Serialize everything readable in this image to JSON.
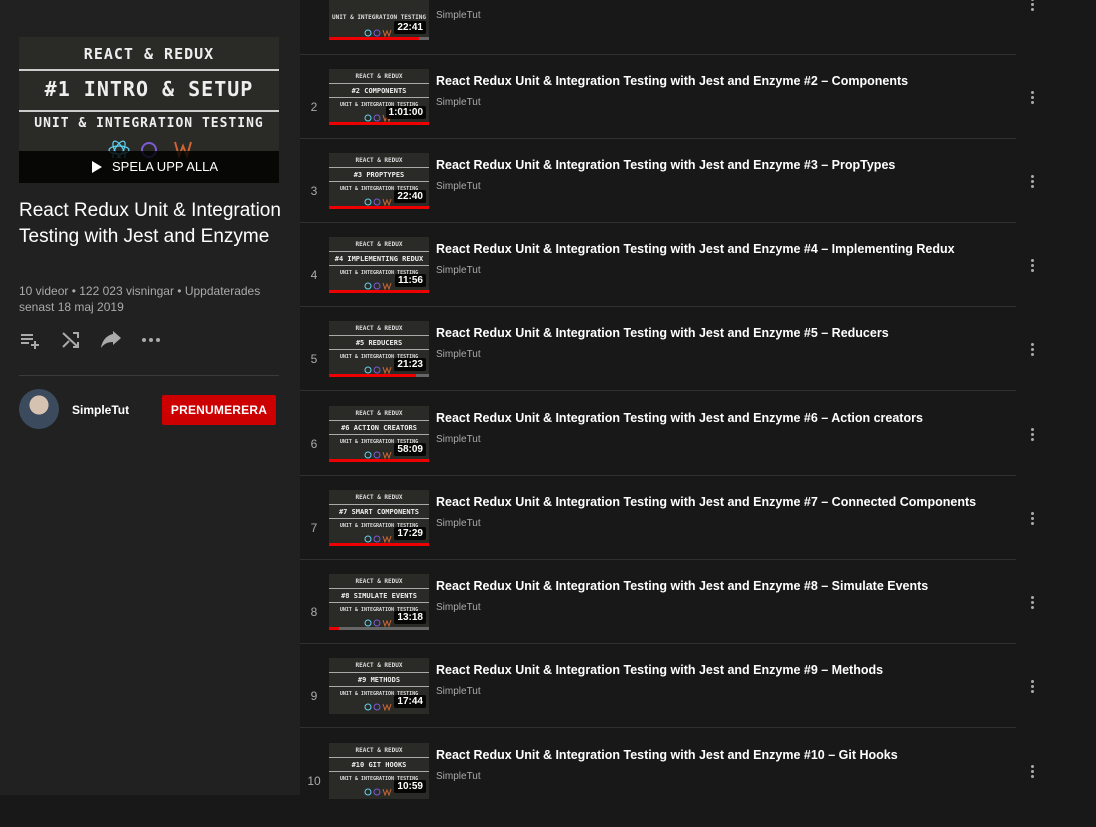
{
  "playlist": {
    "hero": {
      "line1": "REACT & REDUX",
      "line2": "#1 INTRO & SETUP",
      "line3": "UNIT & INTEGRATION TESTING",
      "play_all": "SPELA UPP ALLA"
    },
    "title": "React Redux Unit & Integration Testing with Jest and Enzyme",
    "meta": "10 videor • 122 023 visningar • Uppdaterades senast 18 maj 2019",
    "actions": [
      "add-to-queue-icon",
      "shuffle-icon",
      "share-icon",
      "more-horizontal-icon"
    ],
    "owner": "SimpleTut",
    "subscribe_label": "PRENUMERERA"
  },
  "thumb_common": {
    "top": "REACT & REDUX",
    "sub": "UNIT & INTEGRATION TESTING"
  },
  "partial_row": {
    "channel": "SimpleTut",
    "duration": "22:41",
    "progress": 0.9
  },
  "videos": [
    {
      "index": "2",
      "thumb_label": "#2 COMPONENTS",
      "title": "React Redux Unit & Integration Testing with Jest and Enzyme #2 – Components",
      "channel": "SimpleTut",
      "duration": "1:01:00",
      "progress": 1.0
    },
    {
      "index": "3",
      "thumb_label": "#3 PROPTYPES",
      "title": "React Redux Unit & Integration Testing with Jest and Enzyme #3 – PropTypes",
      "channel": "SimpleTut",
      "duration": "22:40",
      "progress": 1.0
    },
    {
      "index": "4",
      "thumb_label": "#4 IMPLEMENTING REDUX",
      "title": "React Redux Unit & Integration Testing with Jest and Enzyme #4 – Implementing Redux",
      "channel": "SimpleTut",
      "duration": "11:56",
      "progress": 1.0
    },
    {
      "index": "5",
      "thumb_label": "#5 REDUCERS",
      "title": "React Redux Unit & Integration Testing with Jest and Enzyme #5 – Reducers",
      "channel": "SimpleTut",
      "duration": "21:23",
      "progress": 0.87
    },
    {
      "index": "6",
      "thumb_label": "#6 ACTION CREATORS",
      "title": "React Redux Unit & Integration Testing with Jest and Enzyme #6 – Action creators",
      "channel": "SimpleTut",
      "duration": "58:09",
      "progress": 1.0
    },
    {
      "index": "7",
      "thumb_label": "#7 SMART COMPONENTS",
      "title": "React Redux Unit & Integration Testing with Jest and Enzyme #7 – Connected Components",
      "channel": "SimpleTut",
      "duration": "17:29",
      "progress": 1.0
    },
    {
      "index": "8",
      "thumb_label": "#8 SIMULATE EVENTS",
      "title": "React Redux Unit & Integration Testing with Jest and Enzyme #8 – Simulate Events",
      "channel": "SimpleTut",
      "duration": "13:18",
      "progress": 0.1
    },
    {
      "index": "9",
      "thumb_label": "#9 METHODS",
      "title": "React Redux Unit & Integration Testing with Jest and Enzyme #9 – Methods",
      "channel": "SimpleTut",
      "duration": "17:44",
      "progress": 0
    },
    {
      "index": "10",
      "thumb_label": "#10 GIT HOOKS",
      "title": "React Redux Unit & Integration Testing with Jest and Enzyme #10 – Git Hooks",
      "channel": "SimpleTut",
      "duration": "10:59",
      "progress": 0
    }
  ],
  "colors": {
    "background": "#181818",
    "sidebar": "#212121",
    "subscribe": "#cc0000",
    "progress": "#ee0000",
    "muted_text": "#aaaaaa"
  }
}
